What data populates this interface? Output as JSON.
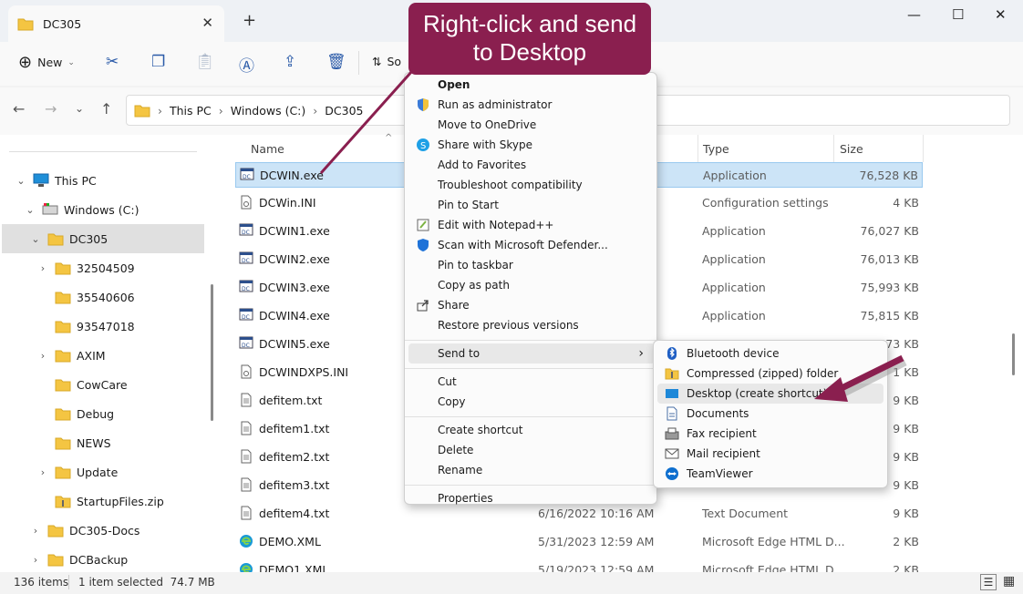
{
  "window": {
    "tab_title": "DC305",
    "new_tab": "+",
    "minimize": "—",
    "maximize": "☐",
    "close": "✕"
  },
  "toolbar": {
    "new_label": "New",
    "sort_label": "So"
  },
  "address": {
    "crumbs": [
      "This PC",
      "Windows (C:)",
      "DC305"
    ]
  },
  "sidebar": {
    "items": [
      {
        "label": "This PC",
        "chev": "v",
        "indent": 0
      },
      {
        "label": "Windows (C:)",
        "chev": "v",
        "indent": 1
      },
      {
        "label": "DC305",
        "chev": "v",
        "indent": 2
      },
      {
        "label": "32504509",
        "chev": ">",
        "indent": 3
      },
      {
        "label": "35540606",
        "chev": "",
        "indent": 3
      },
      {
        "label": "93547018",
        "chev": "",
        "indent": 3
      },
      {
        "label": "AXIM",
        "chev": ">",
        "indent": 3
      },
      {
        "label": "CowCare",
        "chev": "",
        "indent": 3
      },
      {
        "label": "Debug",
        "chev": "",
        "indent": 3
      },
      {
        "label": "NEWS",
        "chev": "",
        "indent": 3
      },
      {
        "label": "Update",
        "chev": ">",
        "indent": 3
      },
      {
        "label": "StartupFiles.zip",
        "chev": "",
        "indent": 3
      },
      {
        "label": "DC305-Docs",
        "chev": ">",
        "indent": 2
      },
      {
        "label": "DCBackup",
        "chev": ">",
        "indent": 2
      }
    ]
  },
  "columns": {
    "name": "Name",
    "type": "Type",
    "size": "Size"
  },
  "files": [
    {
      "name": "DCWIN.exe",
      "date": "",
      "type": "Application",
      "size": "76,528 KB",
      "icon": "exe"
    },
    {
      "name": "DCWin.INI",
      "date": "",
      "type": "Configuration settings",
      "size": "4 KB",
      "icon": "ini"
    },
    {
      "name": "DCWIN1.exe",
      "date": "",
      "type": "Application",
      "size": "76,027 KB",
      "icon": "exe"
    },
    {
      "name": "DCWIN2.exe",
      "date": "",
      "type": "Application",
      "size": "76,013 KB",
      "icon": "exe"
    },
    {
      "name": "DCWIN3.exe",
      "date": "",
      "type": "Application",
      "size": "75,993 KB",
      "icon": "exe"
    },
    {
      "name": "DCWIN4.exe",
      "date": "",
      "type": "Application",
      "size": "75,815 KB",
      "icon": "exe"
    },
    {
      "name": "DCWIN5.exe",
      "date": "",
      "type": "",
      "size": "473 KB",
      "icon": "exe"
    },
    {
      "name": "DCWINDXPS.INI",
      "date": "",
      "type": "",
      "size": "1 KB",
      "icon": "ini"
    },
    {
      "name": "defitem.txt",
      "date": "",
      "type": "",
      "size": "9 KB",
      "icon": "txt"
    },
    {
      "name": "defitem1.txt",
      "date": "",
      "type": "",
      "size": "9 KB",
      "icon": "txt"
    },
    {
      "name": "defitem2.txt",
      "date": "",
      "type": "",
      "size": "9 KB",
      "icon": "txt"
    },
    {
      "name": "defitem3.txt",
      "date": "",
      "type": "",
      "size": "9 KB",
      "icon": "txt"
    },
    {
      "name": "defitem4.txt",
      "date": "6/16/2022 10:16 AM",
      "type": "Text Document",
      "size": "9 KB",
      "icon": "txt"
    },
    {
      "name": "DEMO.XML",
      "date": "5/31/2023 12:59 AM",
      "type": "Microsoft Edge HTML D...",
      "size": "2 KB",
      "icon": "edge"
    },
    {
      "name": "DEMO1.XML",
      "date": "5/19/2023 12:59 AM",
      "type": "Microsoft Edge HTML D...",
      "size": "2 KB",
      "icon": "edge"
    }
  ],
  "context_menu": [
    {
      "label": "Open",
      "bold": true,
      "icon": ""
    },
    {
      "label": "Run as administrator",
      "icon": "shield"
    },
    {
      "label": "Move to OneDrive",
      "icon": ""
    },
    {
      "label": "Share with Skype",
      "icon": "skype"
    },
    {
      "label": "Add to Favorites",
      "icon": ""
    },
    {
      "label": "Troubleshoot compatibility",
      "icon": ""
    },
    {
      "label": "Pin to Start",
      "icon": ""
    },
    {
      "label": "Edit with Notepad++",
      "icon": "notepad"
    },
    {
      "label": "Scan with Microsoft Defender...",
      "icon": "defender"
    },
    {
      "label": "Pin to taskbar",
      "icon": ""
    },
    {
      "label": "Copy as path",
      "icon": ""
    },
    {
      "label": "Share",
      "icon": "share"
    },
    {
      "label": "Restore previous versions",
      "icon": ""
    },
    {
      "label": "Send to",
      "icon": "",
      "sep_before": true,
      "arrow": "›"
    },
    {
      "label": "Cut",
      "icon": "",
      "sep_before": true
    },
    {
      "label": "Copy",
      "icon": ""
    },
    {
      "label": "Create shortcut",
      "icon": "",
      "sep_before": true
    },
    {
      "label": "Delete",
      "icon": ""
    },
    {
      "label": "Rename",
      "icon": ""
    },
    {
      "label": "Properties",
      "icon": "",
      "sep_before": true
    }
  ],
  "sendto_menu": [
    {
      "label": "Bluetooth device",
      "icon": "bluetooth"
    },
    {
      "label": "Compressed (zipped) folder",
      "icon": "zip"
    },
    {
      "label": "Desktop (create shortcut)",
      "icon": "desktop"
    },
    {
      "label": "Documents",
      "icon": "docs"
    },
    {
      "label": "Fax recipient",
      "icon": "fax"
    },
    {
      "label": "Mail recipient",
      "icon": "mail"
    },
    {
      "label": "TeamViewer",
      "icon": "teamviewer"
    }
  ],
  "callout": {
    "line1": "Right-click and send",
    "line2": "to Desktop"
  },
  "status": {
    "items": "136 items",
    "selected": "1 item selected  74.7 MB"
  },
  "colors": {
    "callout": "#8a1f4f",
    "selection": "#cce4f7",
    "folder": "#f4c542"
  }
}
